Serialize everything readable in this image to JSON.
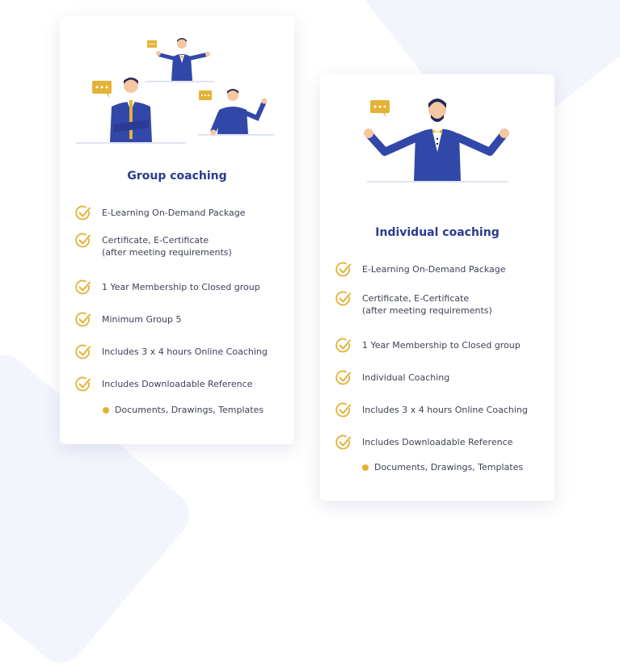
{
  "colors": {
    "accent": "#e4b236",
    "title": "#2a3b8f",
    "suit": "#3248a9",
    "text": "#3d4255"
  },
  "cards": [
    {
      "title": "Group coaching",
      "features": [
        "E-Learning On-Demand Package",
        "Certificate, E-Certificate\n(after meeting requirements)",
        "1 Year Membership to Closed group",
        "Minimum Group 5",
        "Includes 3 x 4 hours Online Coaching",
        "Includes Downloadable Reference"
      ],
      "sub_item": "Documents, Drawings, Templates"
    },
    {
      "title": "Individual coaching",
      "features": [
        "E-Learning On-Demand Package",
        "Certificate, E-Certificate\n(after meeting requirements)",
        "1 Year Membership to Closed group",
        "Individual Coaching",
        "Includes 3 x 4 hours Online Coaching",
        "Includes Downloadable Reference"
      ],
      "sub_item": "Documents, Drawings, Templates"
    }
  ]
}
